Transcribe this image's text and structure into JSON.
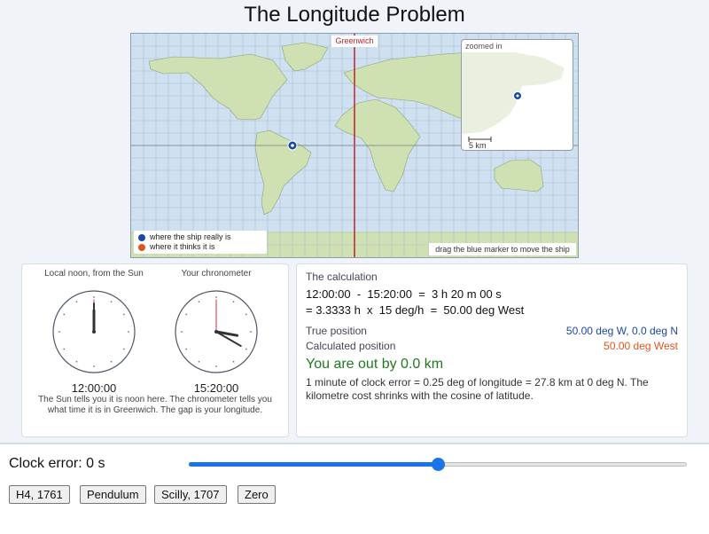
{
  "title": "The Longitude Problem",
  "map": {
    "greenwich_label": "Greenwich",
    "zoom_label": "zoomed in",
    "scale_label": "5 km",
    "legend": [
      {
        "label": "where the ship really is",
        "color": "#1b4aa0"
      },
      {
        "label": "where it thinks it is",
        "color": "#e0551a"
      }
    ],
    "drag_hint": "drag the blue marker to move the ship"
  },
  "clocks": {
    "local": {
      "title": "Local noon, from the Sun",
      "time": "12:00:00"
    },
    "chrono": {
      "title": "Your chronometer",
      "time": "15:20:00"
    },
    "caption": "The Sun tells you it is noon here. The chronometer tells you what time it is in Greenwich. The gap is your longitude."
  },
  "calc": {
    "title": "The calculation",
    "line1": "12:00:00  -  15:20:00  =  3 h 20 m 00 s",
    "line2": "= 3.3333 h  x  15 deg/h  =  50.00 deg West",
    "true_label": "True position",
    "true_value": "50.00 deg W,  0.0 deg N",
    "calc_label": "Calculated position",
    "calc_value": "50.00 deg West",
    "out_by": "You are out by 0.0 km",
    "note": "1 minute of clock error = 0.25 deg of longitude = 27.8 km at 0 deg N. The kilometre cost shrinks with the cosine of latitude."
  },
  "controls": {
    "clock_error_label": "Clock error: 0 s",
    "slider_position": 0.5,
    "presets": [
      "H4, 1761",
      "Pendulum",
      "Scilly, 1707",
      "Zero"
    ]
  },
  "colors": {
    "true": "#1b4aa0",
    "calculated": "#e0551a",
    "greenwich": "#c0232b",
    "good": "#1e7a1e",
    "accent": "#1a73e8"
  }
}
